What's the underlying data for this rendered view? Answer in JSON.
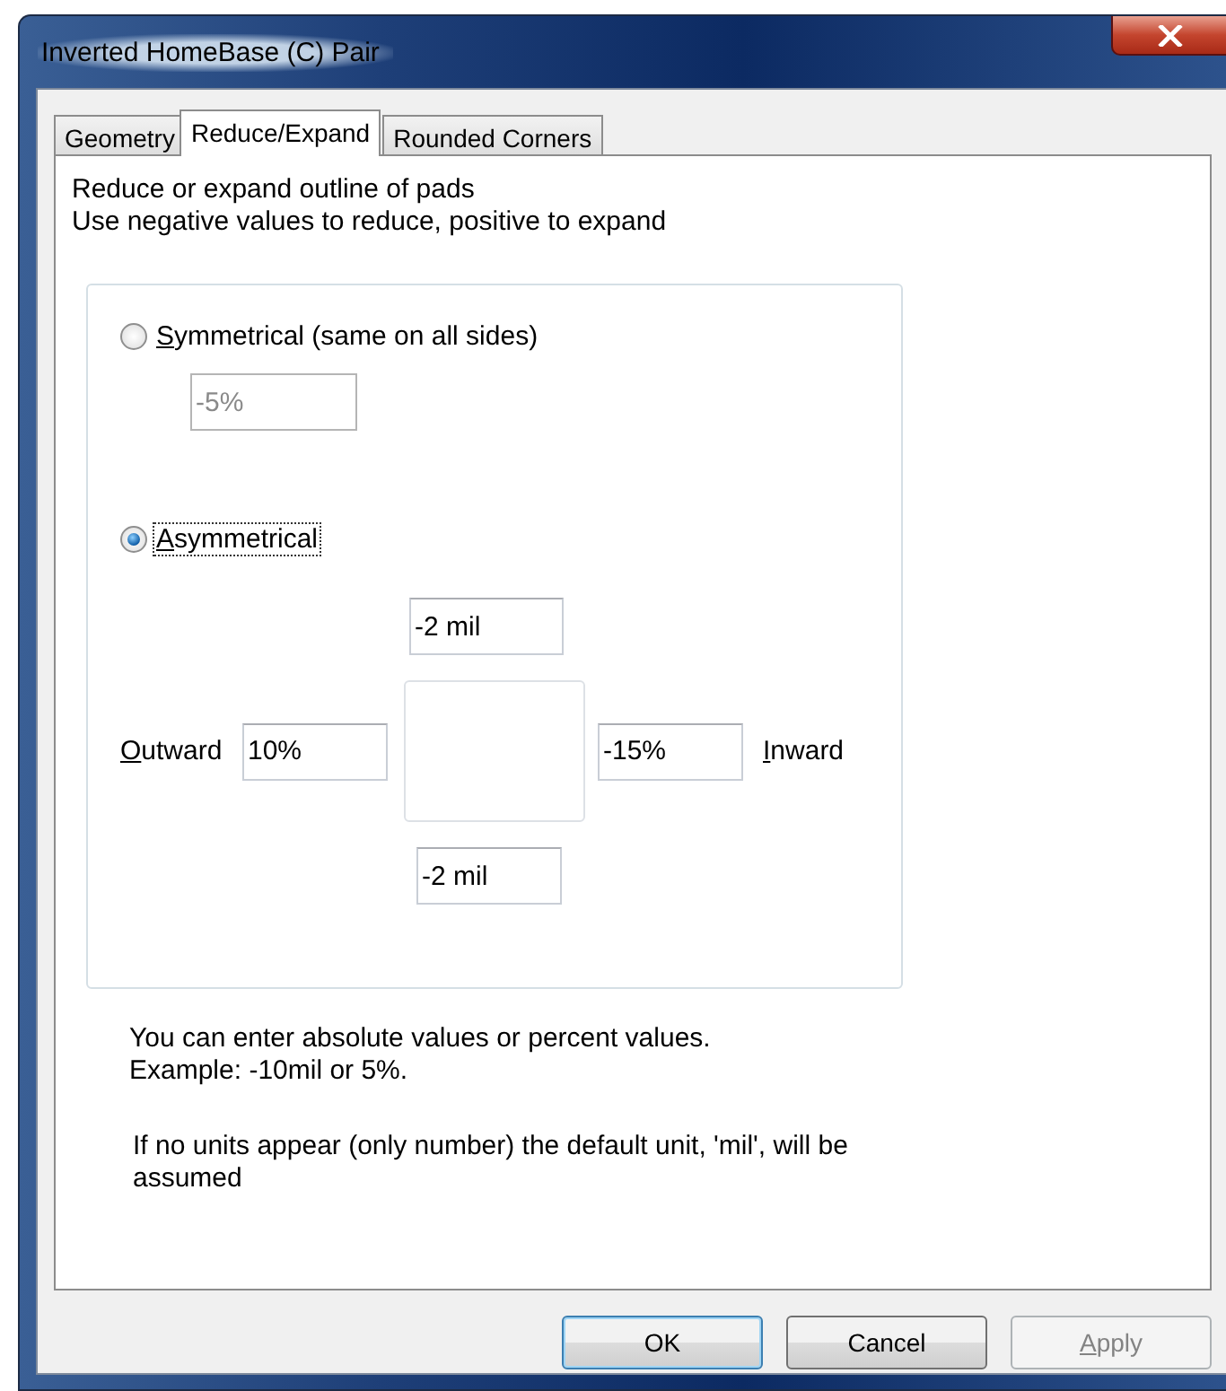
{
  "window": {
    "title": "Inverted HomeBase (C) Pair"
  },
  "tabs": [
    {
      "label": "Geometry",
      "selected": false
    },
    {
      "label": "Reduce/Expand",
      "selected": true
    },
    {
      "label": "Rounded Corners",
      "selected": false
    }
  ],
  "description": [
    "Reduce or expand outline of pads",
    "Use negative values to reduce, positive to expand"
  ],
  "group": {
    "symmetrical": {
      "label": "Symmetrical (same on all sides)",
      "mnemonic": true,
      "selected": false,
      "focused": false
    },
    "symmetrical_value": {
      "value": "-5%",
      "disabled": true
    },
    "asymmetrical": {
      "label": "Asymmetrical",
      "mnemonic": true,
      "selected": true,
      "focused": true
    },
    "top": {
      "value": "-2 mil",
      "disabled": false
    },
    "outward_label": {
      "label": "Outward",
      "mnemonic": true
    },
    "outward": {
      "value": "10%",
      "disabled": false
    },
    "inward": {
      "value": "-15%",
      "disabled": false
    },
    "inward_label": {
      "label": "Inward",
      "mnemonic": true
    },
    "bottom": {
      "value": "-2 mil",
      "disabled": false
    }
  },
  "notes": [
    [
      "You can enter absolute values or percent values.",
      "Example: -10mil or 5%."
    ],
    [
      "If no units appear (only number) the default unit, 'mil', will be",
      "assumed"
    ]
  ],
  "buttons": [
    {
      "label": "OK",
      "default": true,
      "disabled": false,
      "mnemonic": false
    },
    {
      "label": "Cancel",
      "default": false,
      "disabled": false,
      "mnemonic": false
    },
    {
      "label": "Apply",
      "default": false,
      "disabled": true,
      "mnemonic": true
    }
  ]
}
